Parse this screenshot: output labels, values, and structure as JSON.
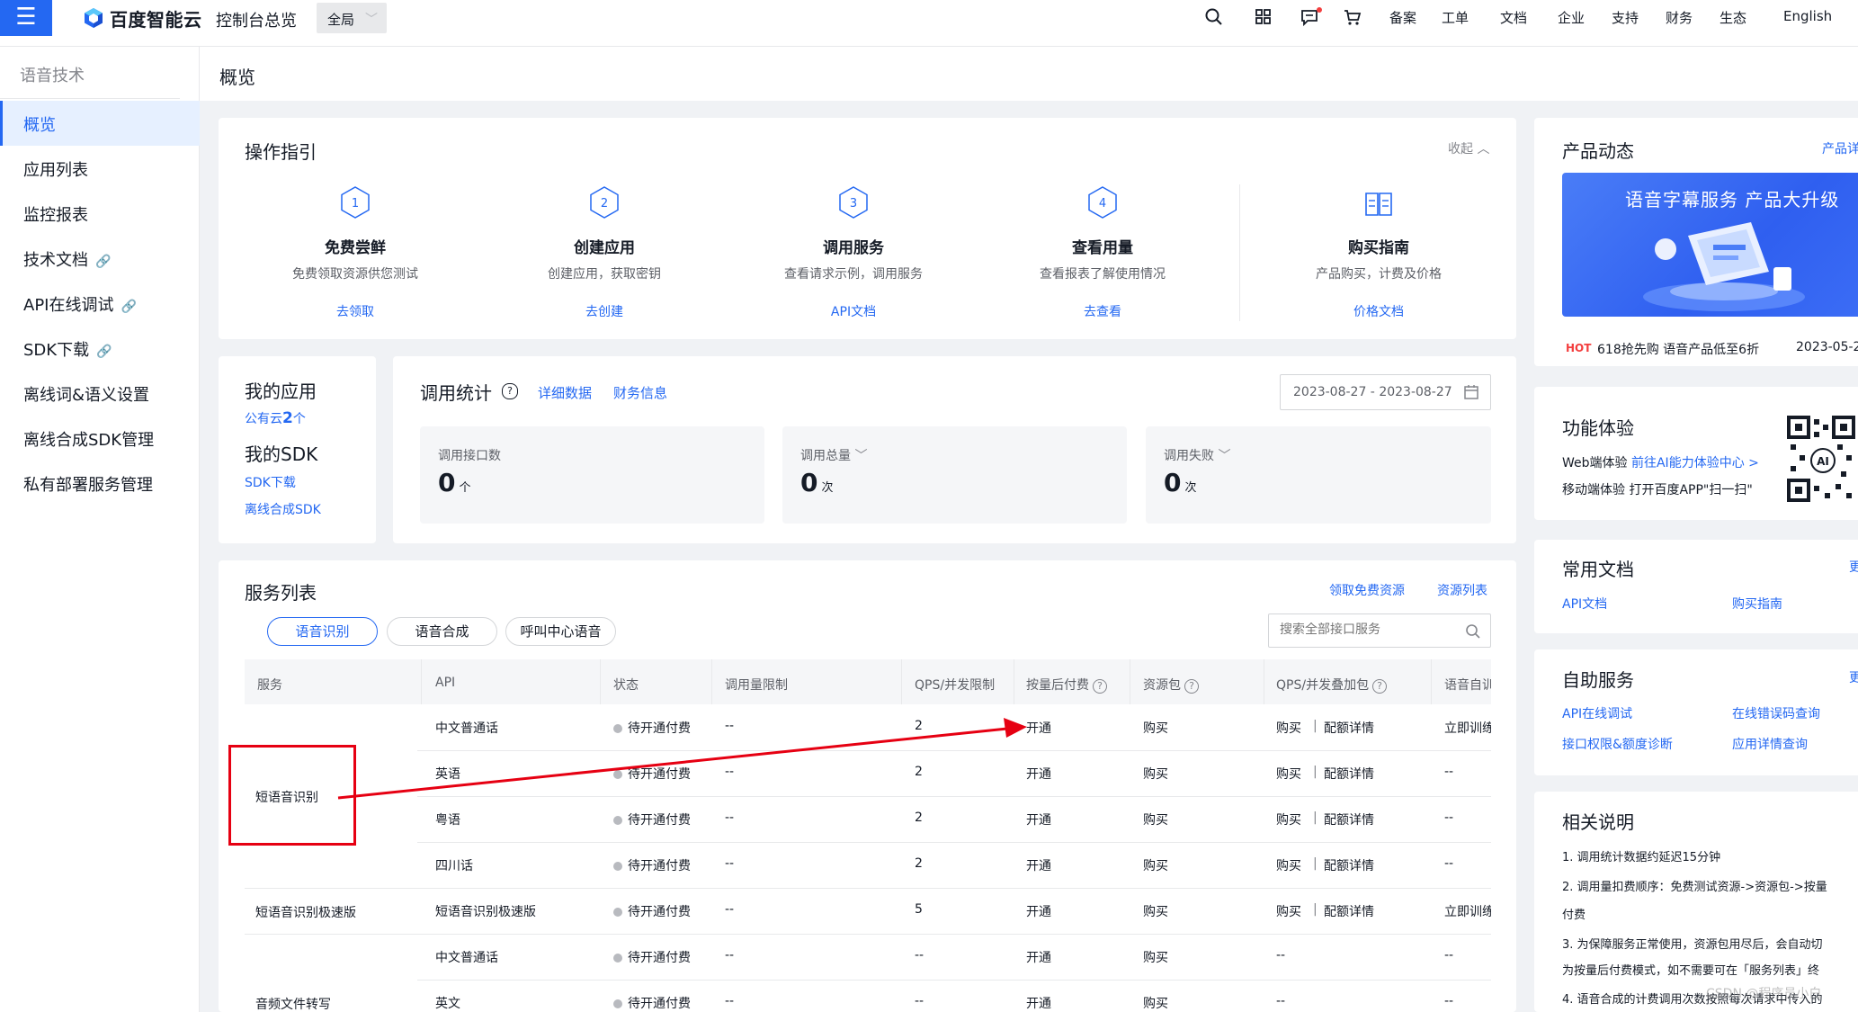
{
  "topbar": {
    "logo_text": "百度智能云",
    "console": "控制台总览",
    "scope": "全局",
    "items": [
      "备案",
      "工单",
      "文档",
      "企业",
      "支持",
      "财务",
      "生态"
    ],
    "lang": "English"
  },
  "sidebar": {
    "title": "语音技术",
    "items": [
      {
        "label": "概览",
        "active": true
      },
      {
        "label": "应用列表"
      },
      {
        "label": "监控报表"
      },
      {
        "label": "技术文档",
        "external": true
      },
      {
        "label": "API在线调试",
        "external": true
      },
      {
        "label": "SDK下载",
        "external": true
      },
      {
        "label": "离线词&语义设置"
      },
      {
        "label": "离线合成SDK管理"
      },
      {
        "label": "私有部署服务管理"
      }
    ]
  },
  "page": {
    "title": "概览"
  },
  "guide": {
    "title": "操作指引",
    "collapse": "收起",
    "steps": [
      {
        "num": "1",
        "title": "免费尝鲜",
        "desc": "免费领取资源供您测试",
        "link": "去领取"
      },
      {
        "num": "2",
        "title": "创建应用",
        "desc": "创建应用，获取密钥",
        "link": "去创建"
      },
      {
        "num": "3",
        "title": "调用服务",
        "desc": "查看请求示例，调用服务",
        "link": "API文档"
      },
      {
        "num": "4",
        "title": "查看用量",
        "desc": "查看报表了解使用情况",
        "link": "去查看"
      },
      {
        "num": "",
        "title": "购买指南",
        "desc": "产品购买，计费及价格",
        "link": "价格文档"
      }
    ]
  },
  "my_apps": {
    "title": "我的应用",
    "public_cloud_prefix": "公有云",
    "public_cloud_count": "2",
    "public_cloud_suffix": "个",
    "sdk_title": "我的SDK",
    "sdk_download": "SDK下载",
    "offline_sdk": "离线合成SDK"
  },
  "stats": {
    "title": "调用统计",
    "detail": "详细数据",
    "finance": "财务信息",
    "date_range": "2023-08-27 - 2023-08-27",
    "cards": [
      {
        "label": "调用接口数",
        "value": "0",
        "unit": "个"
      },
      {
        "label": "调用总量",
        "value": "0",
        "unit": "次"
      },
      {
        "label": "调用失败",
        "value": "0",
        "unit": "次"
      }
    ]
  },
  "services": {
    "title": "服务列表",
    "free_resource": "领取免费资源",
    "resource_list": "资源列表",
    "tabs": [
      "语音识别",
      "语音合成",
      "呼叫中心语音"
    ],
    "search_placeholder": "搜索全部接口服务",
    "columns": [
      "服务",
      "API",
      "状态",
      "调用量限制",
      "QPS/并发限制",
      "按量后付费",
      "资源包",
      "QPS/并发叠加包",
      "语音自训"
    ],
    "groups": [
      {
        "service": "短语音识别",
        "highlighted": true
      },
      {
        "service": "短语音识别极速版"
      },
      {
        "service": "音频文件转写"
      }
    ],
    "rows": [
      {
        "api": "中文普通话",
        "status": "待开通付费",
        "limit": "--",
        "qps": "2",
        "pay": "开通",
        "pack": "购买",
        "qps_buy": "购买",
        "qps_detail": "配额详情",
        "train": "立即训练"
      },
      {
        "api": "英语",
        "status": "待开通付费",
        "limit": "--",
        "qps": "2",
        "pay": "开通",
        "pack": "购买",
        "qps_buy": "购买",
        "qps_detail": "配额详情",
        "train": "--"
      },
      {
        "api": "粤语",
        "status": "待开通付费",
        "limit": "--",
        "qps": "2",
        "pay": "开通",
        "pack": "购买",
        "qps_buy": "购买",
        "qps_detail": "配额详情",
        "train": "--"
      },
      {
        "api": "四川话",
        "status": "待开通付费",
        "limit": "--",
        "qps": "2",
        "pay": "开通",
        "pack": "购买",
        "qps_buy": "购买",
        "qps_detail": "配额详情",
        "train": "--"
      },
      {
        "api": "短语音识别极速版",
        "status": "待开通付费",
        "limit": "--",
        "qps": "5",
        "pay": "开通",
        "pack": "购买",
        "qps_buy": "购买",
        "qps_detail": "配额详情",
        "train": "立即训练"
      },
      {
        "api": "中文普通话",
        "status": "待开通付费",
        "limit": "--",
        "qps": "--",
        "pay": "开通",
        "pack": "购买",
        "qps_buy": "--",
        "qps_detail": "",
        "train": "--"
      },
      {
        "api": "英文",
        "status": "待开通付费",
        "limit": "--",
        "qps": "--",
        "pay": "开通",
        "pack": "购买",
        "qps_buy": "--",
        "qps_detail": "",
        "train": "--"
      }
    ]
  },
  "news": {
    "title": "产品动态",
    "more": "产品详",
    "banner_title": "语音字幕服务 产品大升级",
    "hot": "HOT",
    "hot_text": "618抢先购 语音产品低至6折",
    "hot_date": "2023-05-2"
  },
  "experience": {
    "title": "功能体验",
    "web_label": "Web端体验",
    "web_link": "前往AI能力体验中心 >",
    "mobile": "移动端体验 打开百度APP\"扫一扫\""
  },
  "docs": {
    "title": "常用文档",
    "more": "更",
    "links": [
      "API文档",
      "购买指南"
    ]
  },
  "self_service": {
    "title": "自助服务",
    "more": "更",
    "links": [
      "API在线调试",
      "在线错误码查询",
      "接口权限&额度诊断",
      "应用详情查询"
    ]
  },
  "notes": {
    "title": "相关说明",
    "lines": [
      "1. 调用统计数据约延迟15分钟",
      "2. 调用量扣费顺序：免费测试资源->资源包->按量",
      "付费",
      "3. 为保障服务正常使用，资源包用尽后，会自动切",
      "为按量后付费模式，如不需要可在「服务列表」终",
      "4. 语音合成的计费调用次数按照每次请求中传入的"
    ]
  },
  "watermark": "CSDN @程序员小白"
}
